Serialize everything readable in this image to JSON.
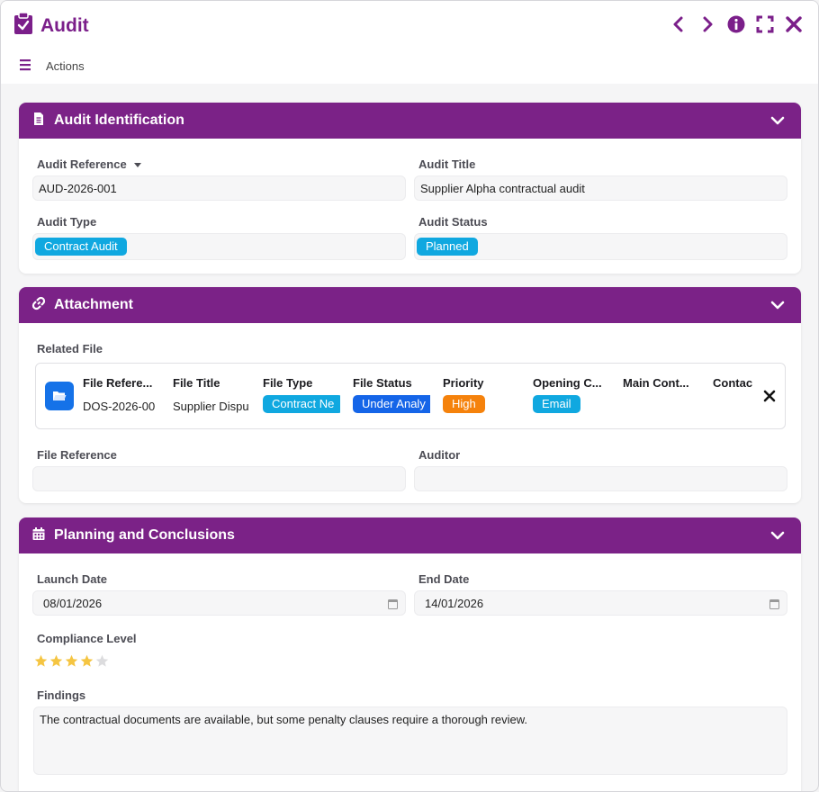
{
  "app": {
    "title": "Audit",
    "actions_label": "Actions"
  },
  "colors": {
    "brand": "#7b2287",
    "chip_blue": "#10a8e0",
    "chip_darkblue": "#1565e8",
    "chip_orange": "#f5820c",
    "star": "#f5c542"
  },
  "icons": {
    "header": "clipboard-check-icon",
    "nav": [
      "chevron-left-icon",
      "chevron-right-icon",
      "info-icon",
      "fullscreen-icon",
      "close-icon"
    ],
    "menu": "hamburger-icon"
  },
  "identification": {
    "title": "Audit Identification",
    "reference_label": "Audit Reference",
    "reference_value": "AUD-2026-001",
    "title_label": "Audit Title",
    "title_value": "Supplier Alpha contractual audit",
    "type_label": "Audit Type",
    "type_value": "Contract Audit",
    "status_label": "Audit Status",
    "status_value": "Planned"
  },
  "attachment": {
    "title": "Attachment",
    "related_label": "Related File",
    "columns": [
      "File Refere...",
      "File Title",
      "File Type",
      "File Status",
      "Priority",
      "Opening C...",
      "Main Cont...",
      "Contac"
    ],
    "row": {
      "file_reference": "DOS-2026-00",
      "file_title": "Supplier Dispu",
      "file_type": "Contract Ne",
      "file_status": "Under Analy",
      "priority": "High",
      "opening_channel": "Email",
      "main_contact": "",
      "contact": ""
    },
    "file_reference_label": "File Reference",
    "file_reference_value": "",
    "auditor_label": "Auditor",
    "auditor_value": ""
  },
  "planning": {
    "title": "Planning and Conclusions",
    "launch_label": "Launch Date",
    "launch_value": "08/01/2026",
    "end_label": "End Date",
    "end_value": "14/01/2026",
    "compliance_label": "Compliance Level",
    "compliance_rating": 4,
    "compliance_max": 5,
    "findings_label": "Findings",
    "findings_value": "The contractual documents are available, but some penalty clauses require a thorough review."
  }
}
